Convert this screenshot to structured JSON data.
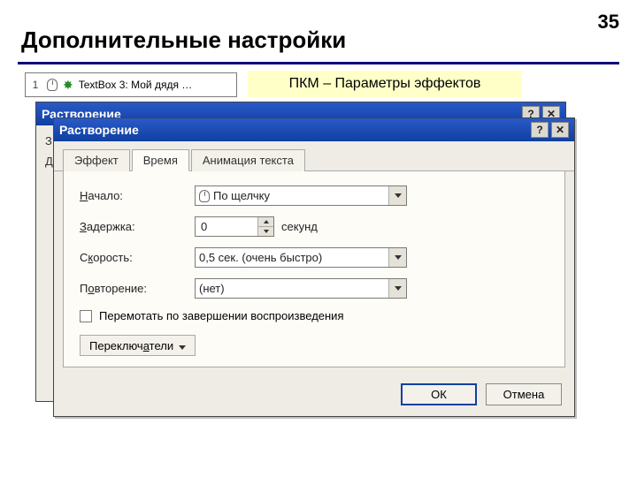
{
  "page": {
    "number": "35",
    "title": "Дополнительные настройки"
  },
  "anim_item": {
    "index": "1",
    "label": "TextBox 3: Мой дядя …"
  },
  "callout": "ПКМ – Параметры эффектов",
  "back_dialog": {
    "title": "Растворение",
    "body_line1": "З",
    "body_line2": "Д"
  },
  "dialog": {
    "title": "Растворение",
    "tabs": {
      "effect": "Эффект",
      "time": "Время",
      "text_anim": "Анимация текста"
    },
    "labels": {
      "start_pre": "Н",
      "start_post": "ачало:",
      "delay_pre": "З",
      "delay_post": "адержка:",
      "speed_pre": "С",
      "speed_char": "к",
      "speed_post": "орость:",
      "repeat_pre": "П",
      "repeat_char": "о",
      "repeat_post": "вторение:",
      "unit": "секунд",
      "rewind": "Перемотать по завершении воспроизведения",
      "toggles_pre": "Переключ",
      "toggles_char": "а",
      "toggles_post": "тели"
    },
    "values": {
      "start": "По щелчку",
      "delay": "0",
      "speed": "0,5 сек. (очень быстро)",
      "repeat": "(нет)"
    },
    "buttons": {
      "ok": "ОК",
      "cancel": "Отмена",
      "help": "?",
      "close": "✕"
    }
  }
}
